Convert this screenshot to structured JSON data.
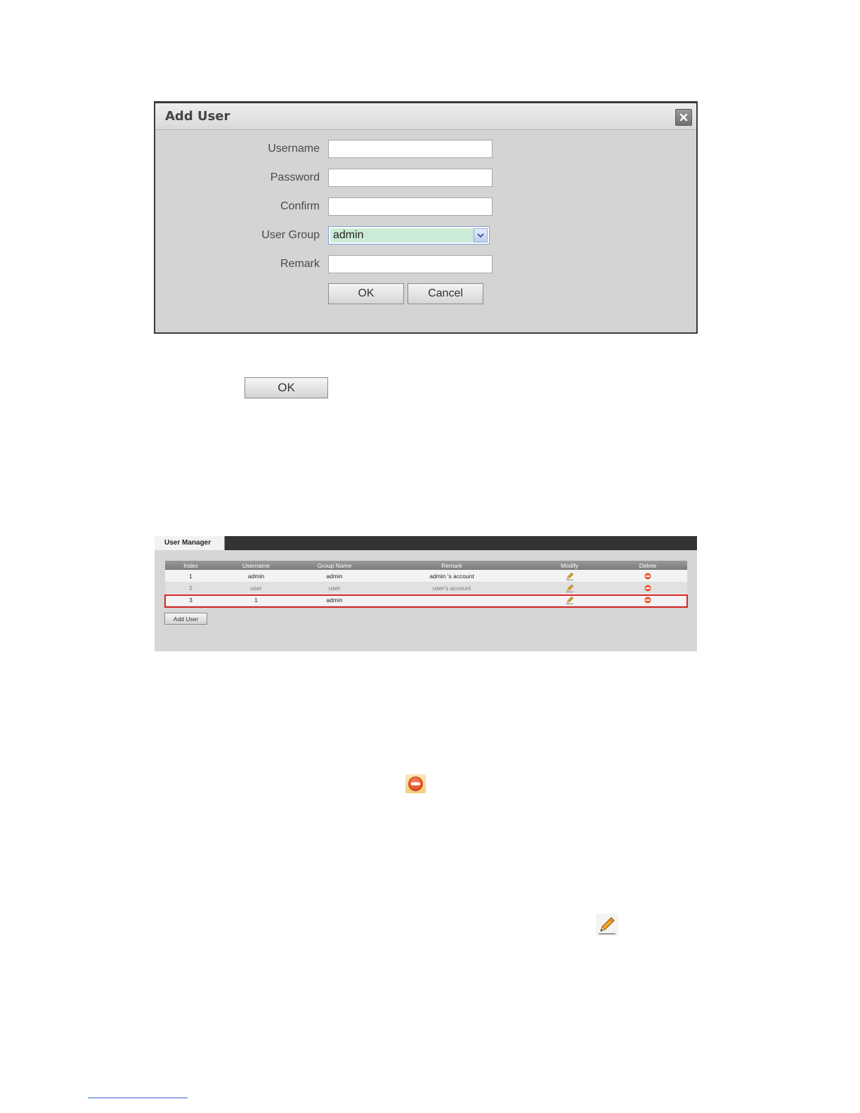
{
  "dialog": {
    "title": "Add User",
    "fields": [
      {
        "label": "Username",
        "value": ""
      },
      {
        "label": "Password",
        "value": ""
      },
      {
        "label": "Confirm",
        "value": ""
      }
    ],
    "user_group": {
      "label": "User Group",
      "value": "admin"
    },
    "remark": {
      "label": "Remark",
      "value": ""
    },
    "ok_label": "OK",
    "cancel_label": "Cancel"
  },
  "standalone_ok_label": "OK",
  "user_manager": {
    "tab": "User Manager",
    "columns": [
      "Index",
      "Username",
      "Group Name",
      "Remark",
      "Modify",
      "Delete"
    ],
    "rows": [
      {
        "index": "1",
        "username": "admin",
        "group": "admin",
        "remark": "admin 's account"
      },
      {
        "index": "2",
        "username": "user",
        "group": "user",
        "remark": "user's account"
      },
      {
        "index": "3",
        "username": "1",
        "group": "admin",
        "remark": ""
      }
    ],
    "add_user_label": "Add User"
  },
  "colors": {
    "highlight": "#d52525",
    "select_fill": "#ccebd6",
    "delete_icon": "#e8542a",
    "link": "#3b5bd3"
  },
  "icons": [
    "close-icon",
    "chevron-down-icon",
    "pencil-icon",
    "minus-circle-icon"
  ]
}
